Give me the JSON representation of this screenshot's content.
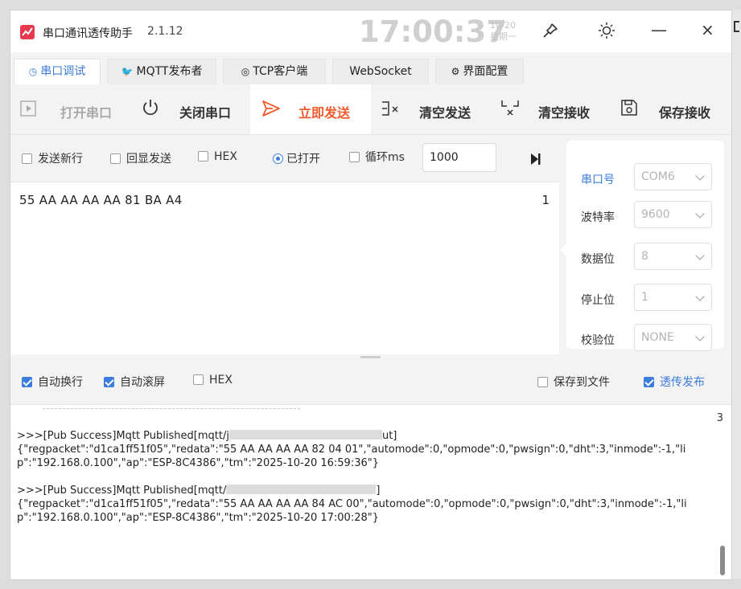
{
  "app": {
    "title": "串口通讯透传助手",
    "version": "2.1.12",
    "clock": "17:00:37",
    "date": "10-20",
    "weekday": "星期一",
    "accent_color": "#3b7ddd",
    "send_color": "#f25a2c",
    "icon_color": "#e8384f"
  },
  "window_controls": {
    "pin": "pin-icon",
    "theme": "sun-icon",
    "minimize": "—",
    "close": "×"
  },
  "tabs": [
    {
      "label": "串口调试",
      "icon": "clock-icon"
    },
    {
      "label": "MQTT发布者",
      "icon": "bird-icon"
    },
    {
      "label": "TCP客户端",
      "icon": "eye-icon"
    },
    {
      "label": "WebSocket",
      "icon": ""
    },
    {
      "label": "界面配置",
      "icon": "gear-icon"
    }
  ],
  "toolbar": {
    "open_port": "打开串口",
    "close_port": "关闭串口",
    "send_now": "立即发送",
    "clear_send": "清空发送",
    "clear_recv": "清空接收",
    "save_recv": "保存接收"
  },
  "send_options": {
    "new_line": "发送新行",
    "echo": "回显发送",
    "hex": "HEX",
    "opened": "已打开",
    "loop": "循环ms",
    "interval": "1000"
  },
  "send_area": {
    "text": "55 AA AA AA AA 81 BA A4",
    "count": "1"
  },
  "port_settings": {
    "port_label": "串口号",
    "port_value": "COM6",
    "baud_label": "波特率",
    "baud_value": "9600",
    "databits_label": "数据位",
    "databits_value": "8",
    "stopbits_label": "停止位",
    "stopbits_value": "1",
    "parity_label": "校验位",
    "parity_value": "NONE"
  },
  "recv_options": {
    "auto_wrap": "自动换行",
    "auto_scroll": "自动滚屏",
    "hex": "HEX",
    "save_file": "保存到文件",
    "passthrough": "透传发布"
  },
  "recv_area": {
    "count": "3",
    "log1_head": ">>>[Pub Success]Mqtt Published[mqtt/j",
    "log1_tail": "ut]",
    "log1_body": "{\"regpacket\":\"d1ca1ff51f05\",\"redata\":\"55 AA AA AA AA 82 04 01\",\"automode\":0,\"opmode\":0,\"pwsign\":0,\"dht\":3,\"inmode\":-1,\"lip\":\"192.168.0.100\",\"ap\":\"ESP-8C4386\",\"tm\":\"2025-10-20 16:59:36\"}",
    "log2_head": ">>>[Pub Success]Mqtt Published[mqtt/",
    "log2_tail": "]",
    "log2_body": "{\"regpacket\":\"d1ca1ff51f05\",\"redata\":\"55 AA AA AA AA 84 AC 00\",\"automode\":0,\"opmode\":0,\"pwsign\":0,\"dht\":3,\"inmode\":-1,\"lip\":\"192.168.0.100\",\"ap\":\"ESP-8C4386\",\"tm\":\"2025-10-20 17:00:28\"}"
  }
}
